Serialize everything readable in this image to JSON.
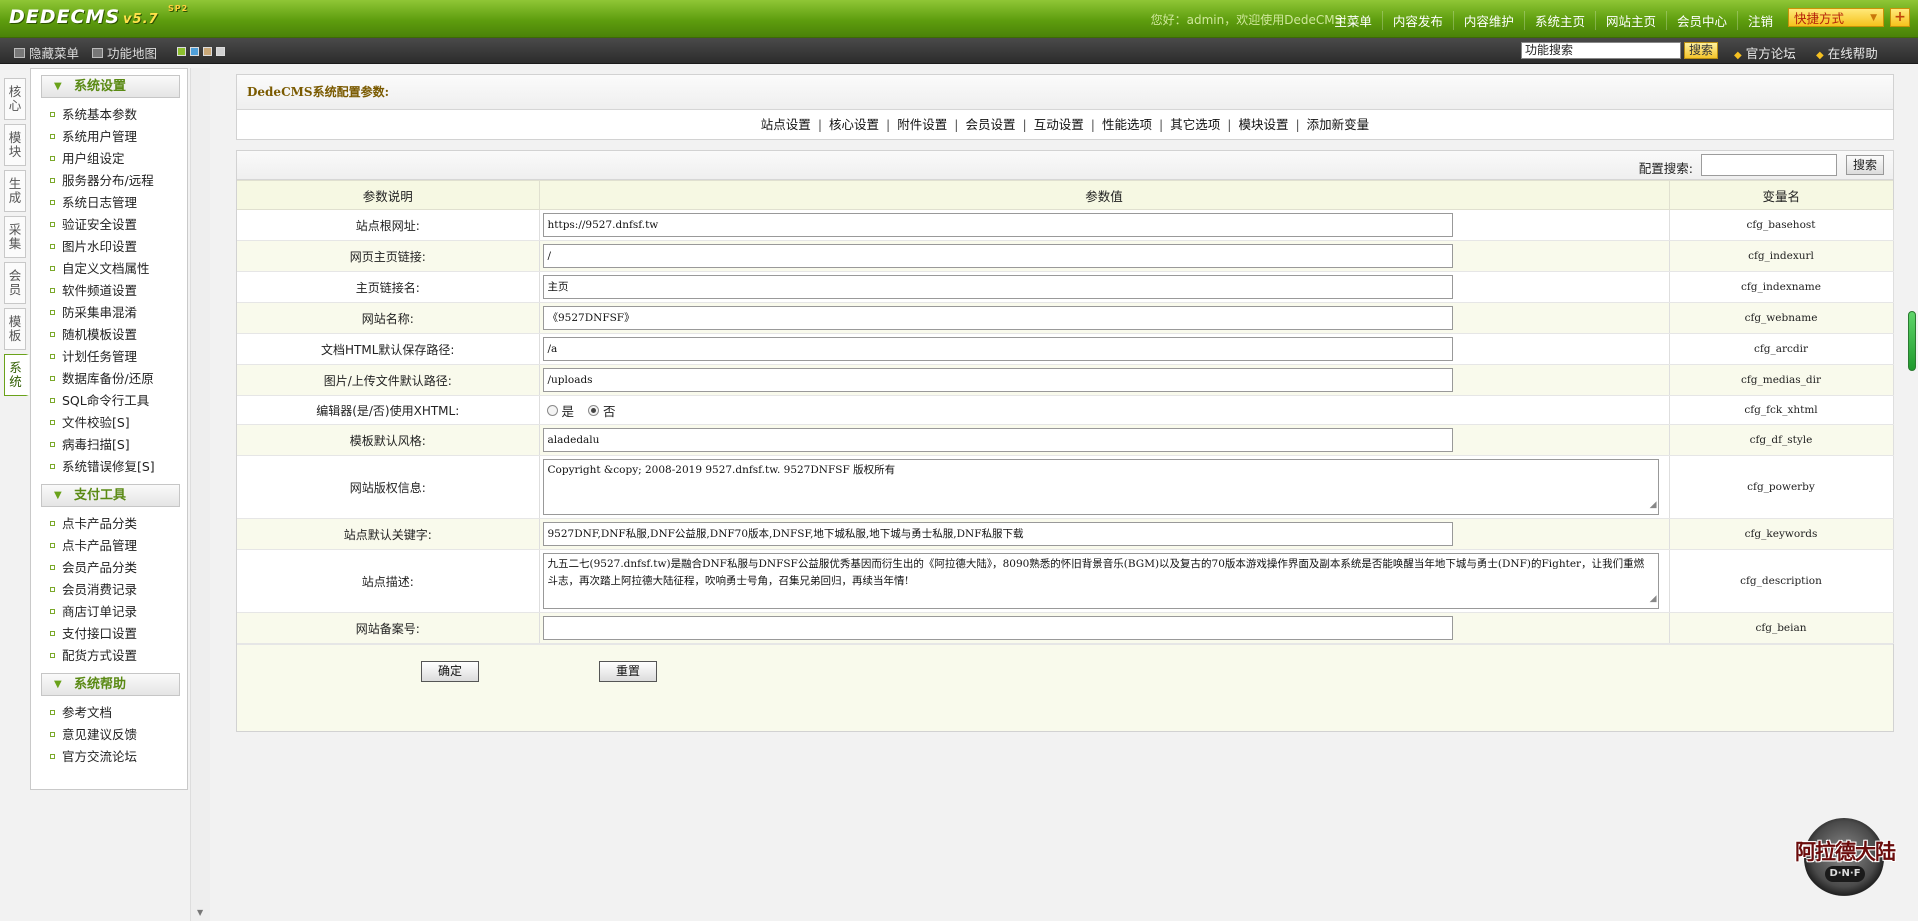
{
  "header": {
    "logo_text": "DEDECMS",
    "logo_version": "v5.7",
    "logo_beta": "SP2",
    "welcome": "您好：admin，欢迎使用DedeCMS!",
    "nav": [
      "主菜单",
      "内容发布",
      "内容维护",
      "系统主页",
      "网站主页",
      "会员中心",
      "注销"
    ],
    "quick_label": "快捷方式",
    "plus_label": "+"
  },
  "toolbar": {
    "hide_menu": "隐藏菜单",
    "func_map": "功能地图",
    "search_value": "功能搜索",
    "search_button": "搜索",
    "forum_link": "官方论坛",
    "help_link": "在线帮助",
    "swatch_colors": [
      "#8dbf2f",
      "#4f9fd8",
      "#c9a878",
      "#d0d0d0"
    ]
  },
  "vtabs": [
    "核心",
    "模块",
    "生成",
    "采集",
    "会员",
    "模板",
    "系统"
  ],
  "sidebar": {
    "sections": [
      {
        "title": "系统设置",
        "items": [
          "系统基本参数",
          "系统用户管理",
          "用户组设定",
          "服务器分布/远程",
          "系统日志管理",
          "验证安全设置",
          "图片水印设置",
          "自定义文档属性",
          "软件频道设置",
          "防采集串混淆",
          "随机模板设置",
          "计划任务管理",
          "数据库备份/还原",
          "SQL命令行工具",
          "文件校验[S]",
          "病毒扫描[S]",
          "系统错误修复[S]"
        ]
      },
      {
        "title": "支付工具",
        "items": [
          "点卡产品分类",
          "点卡产品管理",
          "会员产品分类",
          "会员消费记录",
          "商店订单记录",
          "支付接口设置",
          "配货方式设置"
        ]
      },
      {
        "title": "系统帮助",
        "items": [
          "参考文档",
          "意见建议反馈",
          "官方交流论坛"
        ]
      }
    ]
  },
  "main": {
    "title": "DedeCMS系统配置参数:",
    "categories": [
      "站点设置",
      "核心设置",
      "附件设置",
      "会员设置",
      "互动设置",
      "性能选项",
      "其它选项",
      "模块设置",
      "添加新变量"
    ],
    "search_label": "配置搜索:",
    "search_button": "搜索",
    "columns": [
      "参数说明",
      "参数值",
      "变量名"
    ],
    "rows": [
      {
        "label": "站点根网址:",
        "value": "https://9527.dnfsf.tw",
        "var": "cfg_basehost"
      },
      {
        "label": "网页主页链接:",
        "value": "/",
        "var": "cfg_indexurl"
      },
      {
        "label": "主页链接名:",
        "value": "主页",
        "var": "cfg_indexname"
      },
      {
        "label": "网站名称:",
        "value": "《9527DNFSF》",
        "var": "cfg_webname"
      },
      {
        "label": "文档HTML默认保存路径:",
        "value": "/a",
        "var": "cfg_arcdir"
      },
      {
        "label": "图片/上传文件默认路径:",
        "value": "/uploads",
        "var": "cfg_medias_dir"
      },
      {
        "label": "编辑器(是/否)使用XHTML:",
        "radio_yes": "是",
        "radio_no": "否",
        "var": "cfg_fck_xhtml"
      },
      {
        "label": "模板默认风格:",
        "value": "aladedalu",
        "var": "cfg_df_style"
      },
      {
        "label": "网站版权信息:",
        "value": "Copyright &copy; 2008-2019 9527.dnfsf.tw. 9527DNFSF 版权所有",
        "var": "cfg_powerby"
      },
      {
        "label": "站点默认关键字:",
        "value": "9527DNF,DNF私服,DNF公益服,DNF70版本,DNFSF,地下城私服,地下城与勇士私服,DNF私服下载",
        "var": "cfg_keywords"
      },
      {
        "label": "站点描述:",
        "value": "九五二七(9527.dnfsf.tw)是融合DNF私服与DNFSF公益服优秀基因而衍生出的《阿拉德大陆》，8090熟悉的怀旧背景音乐(BGM)以及复古的70版本游戏操作界面及副本系统是否能唤醒当年地下城与勇士(DNF)的Fighter，让我们重燃斗志，再次踏上阿拉德大陆征程，吹响勇士号角，召集兄弟回归，再续当年情!",
        "var": "cfg_description"
      },
      {
        "label": "网站备案号:",
        "value": "",
        "var": "cfg_beian"
      }
    ],
    "confirm_button": "确定",
    "reset_button": "重置"
  },
  "watermark": {
    "text": "阿拉德大陆",
    "badge": "D·N·F"
  }
}
